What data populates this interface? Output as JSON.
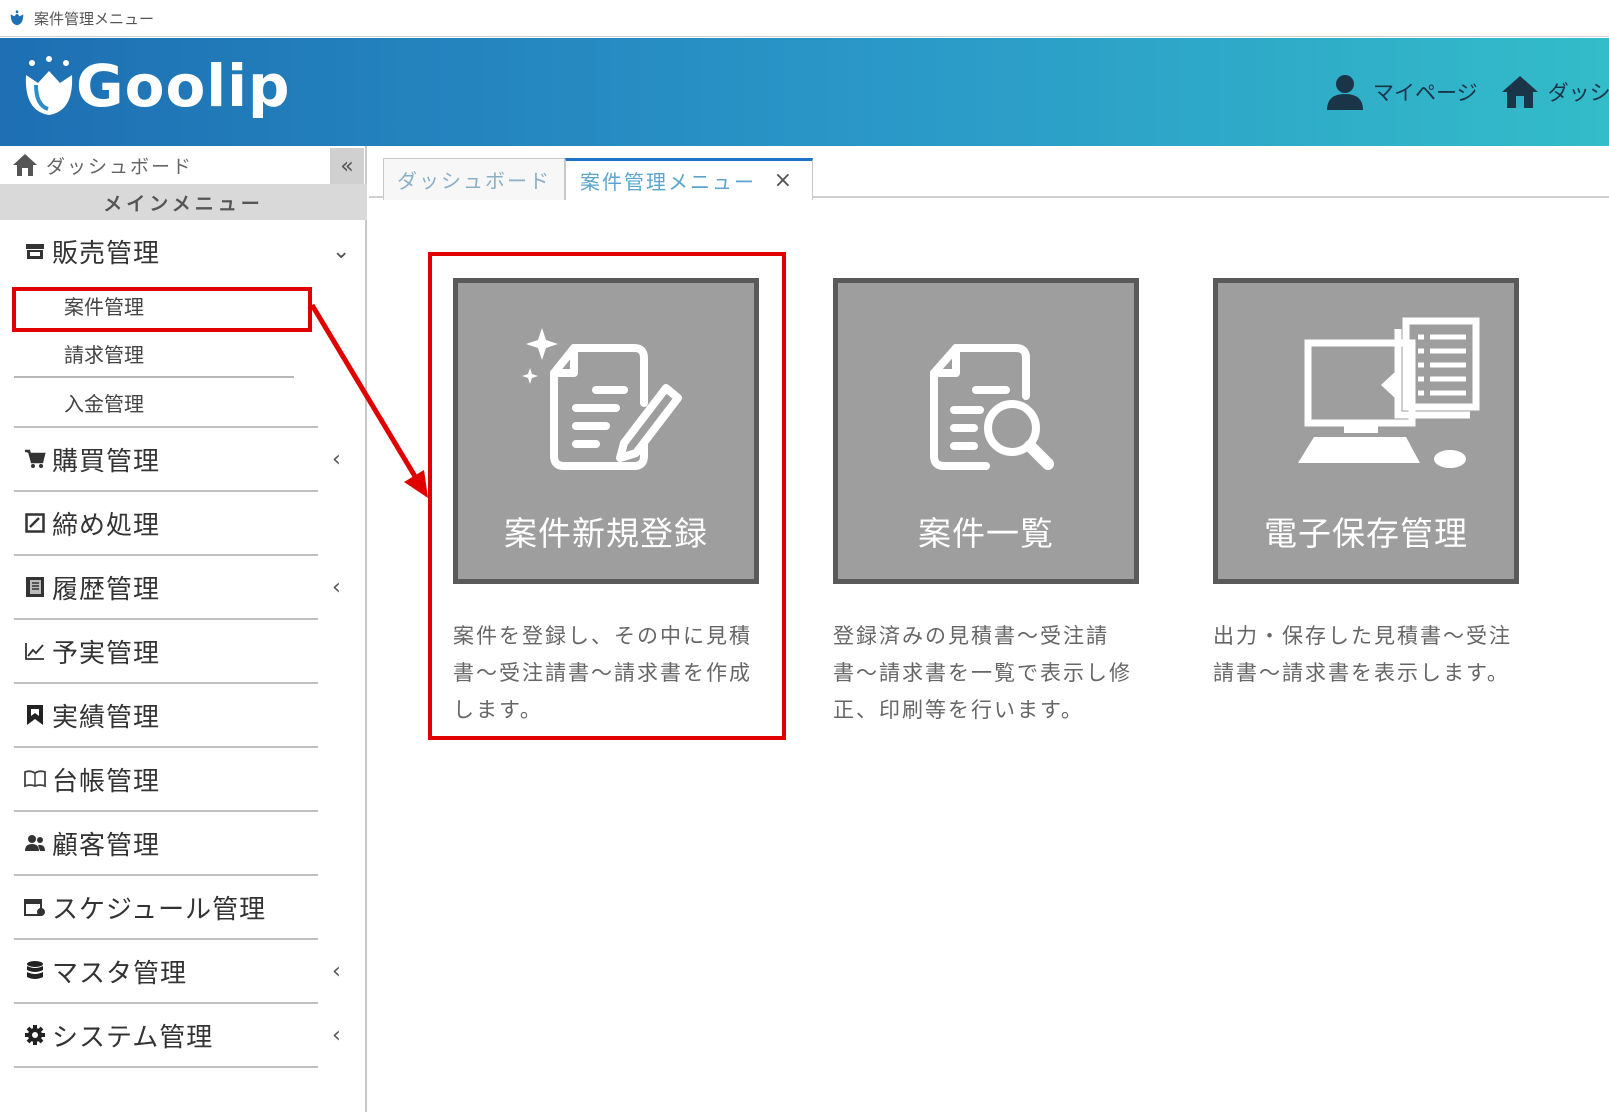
{
  "window": {
    "title": "案件管理メニュー"
  },
  "header": {
    "logo_text": "Goolip",
    "nav": [
      {
        "label": "マイページ",
        "icon": "user-icon"
      },
      {
        "label": "ダッシ",
        "icon": "home-icon"
      }
    ]
  },
  "sidebar": {
    "dashboard_label": "ダッシュボード",
    "collapse_label": "«",
    "heading": "メインメニュー",
    "sales": {
      "label": "販売管理",
      "caret": "⌄",
      "subitems": [
        "案件管理",
        "請求管理",
        "入金管理"
      ]
    },
    "items": [
      {
        "label": "購買管理",
        "icon": "cart-icon",
        "caret": "‹"
      },
      {
        "label": "締め処理",
        "icon": "checkbox-icon",
        "caret": ""
      },
      {
        "label": "履歴管理",
        "icon": "history-icon",
        "caret": "‹"
      },
      {
        "label": "予実管理",
        "icon": "chart-icon",
        "caret": ""
      },
      {
        "label": "実績管理",
        "icon": "bookmark-icon",
        "caret": ""
      },
      {
        "label": "台帳管理",
        "icon": "book-icon",
        "caret": ""
      },
      {
        "label": "顧客管理",
        "icon": "people-icon",
        "caret": ""
      },
      {
        "label": "スケジュール管理",
        "icon": "calendar-icon",
        "caret": ""
      },
      {
        "label": "マスタ管理",
        "icon": "database-icon",
        "caret": "‹"
      },
      {
        "label": "システム管理",
        "icon": "gear-icon",
        "caret": "‹"
      }
    ]
  },
  "tabs": [
    {
      "label": "ダッシュボード",
      "active": false
    },
    {
      "label": "案件管理メニュー",
      "active": true,
      "close": "×"
    }
  ],
  "cards": [
    {
      "label": "案件新規登録",
      "icon": "document-edit-icon",
      "desc": "案件を登録し、その中に見積書〜受注請書〜請求書を作成します。"
    },
    {
      "label": "案件一覧",
      "icon": "document-search-icon",
      "desc": "登録済みの見積書〜受注請書〜請求書を一覧で表示し修正、印刷等を行います。"
    },
    {
      "label": "電子保存管理",
      "icon": "computer-storage-icon",
      "desc": "出力・保存した見積書〜受注請書〜請求書を表示します。"
    }
  ],
  "colors": {
    "header_start": "#1e6fb3",
    "header_end": "#33bcc9",
    "tile_bg": "#9e9e9e",
    "highlight": "#e00000",
    "active_tab": "#1e73c8"
  }
}
